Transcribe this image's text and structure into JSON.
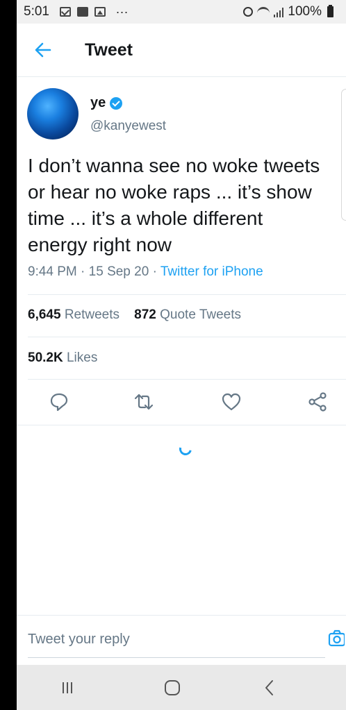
{
  "status_bar": {
    "time": "5:01",
    "left_icons": [
      "mail-icon",
      "video-icon",
      "image-icon"
    ],
    "dots": "...",
    "battery": "100%"
  },
  "header": {
    "title": "Tweet"
  },
  "tweet": {
    "author_name": "ye",
    "handle": "@kanyewest",
    "text": "I don’t wanna see no woke tweets\nor hear no woke raps ... it’s show\ntime ... it’s a whole different\nenergy right now",
    "time": "9:44 PM",
    "separator": "·",
    "date": "15 Sep 20",
    "source": "Twitter for iPhone"
  },
  "stats": {
    "retweets_count": "6,645",
    "retweets_label": "Retweets",
    "quotes_count": "872",
    "quotes_label": "Quote Tweets",
    "likes_count": "50.2K",
    "likes_label": "Likes"
  },
  "reply": {
    "placeholder": "Tweet your reply"
  },
  "colors": {
    "accent": "#1da1f2",
    "secondary_text": "#657786",
    "divider": "#e6ecf0"
  }
}
